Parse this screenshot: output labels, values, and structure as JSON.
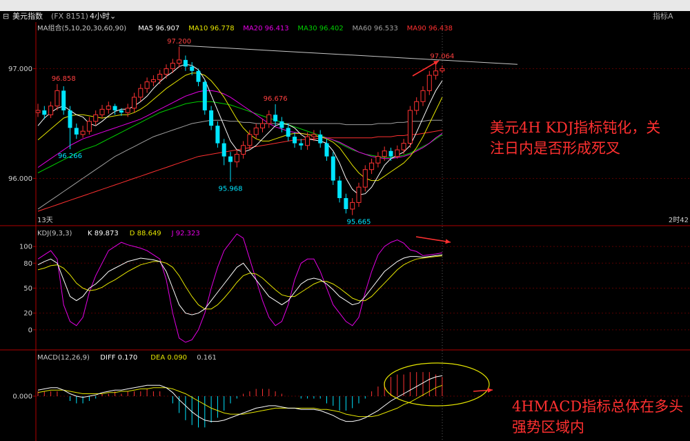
{
  "window": {
    "symbol": "美元指数",
    "code": "(FX 8151)",
    "period": "4小时",
    "right_label": "指标A"
  },
  "colors": {
    "up": "#ff3232",
    "down": "#00e5ff",
    "ma5": "#ffffff",
    "ma10": "#e6e600",
    "ma20": "#e600e6",
    "ma30": "#00d000",
    "ma60": "#a0a0a0",
    "ma90": "#ff3030",
    "grid": "#5a0000",
    "axis": "#b00000"
  },
  "main": {
    "legend": [
      {
        "text": "MA组合(5,10,20,30,60,90)",
        "color": "#c8c8c8"
      },
      {
        "text": "MA5 96.907",
        "color": "#ffffff"
      },
      {
        "text": "MA10 96.778",
        "color": "#e6e600"
      },
      {
        "text": "MA20 96.413",
        "color": "#e600e6"
      },
      {
        "text": "MA30 96.402",
        "color": "#00d000"
      },
      {
        "text": "MA60 96.533",
        "color": "#a0a0a0"
      },
      {
        "text": "MA90 96.438",
        "color": "#ff3030"
      }
    ],
    "y_ticks": [
      "97.000",
      "96.000"
    ],
    "y_tick_values": [
      97.0,
      96.0
    ],
    "ylim": [
      95.6,
      97.4
    ],
    "bottom_left": "13天",
    "bottom_right": "2时42",
    "price_labels": [
      {
        "text": "97.200",
        "i": 22,
        "value": 97.2,
        "pos": "above",
        "color": "#ff4040"
      },
      {
        "text": "96.858",
        "i": 4,
        "value": 96.858,
        "pos": "above",
        "color": "#ff4040"
      },
      {
        "text": "96.266",
        "i": 5,
        "value": 96.266,
        "pos": "below",
        "color": "#00e5ff"
      },
      {
        "text": "95.968",
        "i": 30,
        "value": 95.968,
        "pos": "below",
        "color": "#00e5ff"
      },
      {
        "text": "96.676",
        "i": 37,
        "value": 96.676,
        "pos": "above",
        "color": "#ff4040"
      },
      {
        "text": "95.665",
        "i": 50,
        "value": 95.665,
        "pos": "below",
        "color": "#00e5ff"
      },
      {
        "text": "97.064",
        "i": 63,
        "value": 97.064,
        "pos": "above",
        "color": "#ff4040"
      }
    ]
  },
  "kdj": {
    "legend": [
      {
        "text": "KDJ(9,3,3)",
        "color": "#c8c8c8"
      },
      {
        "text": "K 89.873",
        "color": "#ffffff"
      },
      {
        "text": "D 88.649",
        "color": "#e6e600"
      },
      {
        "text": "J 92.323",
        "color": "#e600e6"
      }
    ],
    "y_ticks": [
      "100",
      "80",
      "50",
      "20",
      "0"
    ],
    "y_tick_values": [
      100,
      80,
      50,
      20,
      0
    ],
    "ylim": [
      -20,
      120
    ]
  },
  "macd": {
    "legend": [
      {
        "text": "MACD(12,26,9)",
        "color": "#c8c8c8"
      },
      {
        "text": "DIFF 0.170",
        "color": "#ffffff"
      },
      {
        "text": "DEA 0.090",
        "color": "#e6e600"
      },
      {
        "text": "0.161",
        "color": "#c8c8c8"
      }
    ],
    "y_ticks": [
      "0.000"
    ],
    "y_tick_values": [
      0.0
    ],
    "ylim": [
      -0.35,
      0.35
    ]
  },
  "annotations": {
    "kdj_note": "美元4H KDJ指标钝化，关\n注日内是否形成死叉",
    "macd_note": "4HMACD指标总体在多头\n强势区域内"
  },
  "chart_data": {
    "type": "candlestick",
    "open": [
      96.6,
      96.62,
      96.58,
      96.66,
      96.8,
      96.62,
      96.46,
      96.4,
      96.43,
      96.52,
      96.58,
      96.63,
      96.66,
      96.62,
      96.6,
      96.64,
      96.74,
      96.82,
      96.88,
      96.9,
      96.95,
      97.0,
      97.05,
      97.08,
      97.02,
      96.98,
      96.88,
      96.62,
      96.48,
      96.32,
      96.2,
      96.15,
      96.22,
      96.3,
      96.4,
      96.46,
      96.5,
      96.58,
      96.52,
      96.46,
      96.38,
      96.32,
      96.3,
      96.38,
      96.4,
      96.32,
      96.2,
      95.98,
      95.82,
      95.72,
      95.78,
      95.92,
      96.08,
      96.14,
      96.2,
      96.25,
      96.2,
      96.26,
      96.32,
      96.62,
      96.7,
      96.8,
      96.94,
      96.98
    ],
    "close": [
      96.62,
      96.58,
      96.66,
      96.8,
      96.62,
      96.46,
      96.4,
      96.43,
      96.52,
      96.58,
      96.63,
      96.66,
      96.62,
      96.6,
      96.64,
      96.74,
      96.82,
      96.88,
      96.9,
      96.95,
      97.0,
      97.05,
      97.08,
      97.02,
      96.98,
      96.88,
      96.62,
      96.48,
      96.32,
      96.2,
      96.15,
      96.22,
      96.3,
      96.4,
      96.46,
      96.5,
      96.58,
      96.52,
      96.46,
      96.38,
      96.32,
      96.3,
      96.38,
      96.4,
      96.32,
      96.2,
      95.98,
      95.82,
      95.72,
      95.78,
      95.92,
      96.08,
      96.14,
      96.2,
      96.25,
      96.2,
      96.26,
      96.32,
      96.62,
      96.7,
      96.8,
      96.94,
      96.98,
      97.0
    ],
    "high": [
      96.68,
      96.66,
      96.7,
      96.86,
      96.84,
      96.66,
      96.5,
      96.48,
      96.56,
      96.62,
      96.67,
      96.7,
      96.68,
      96.64,
      96.68,
      96.78,
      96.86,
      96.92,
      96.94,
      96.99,
      97.04,
      97.09,
      97.2,
      97.12,
      97.06,
      97.0,
      96.9,
      96.66,
      96.52,
      96.36,
      96.24,
      96.26,
      96.34,
      96.44,
      96.5,
      96.54,
      96.62,
      96.676,
      96.56,
      96.5,
      96.42,
      96.36,
      96.42,
      96.44,
      96.44,
      96.36,
      96.24,
      96.02,
      95.86,
      95.82,
      95.96,
      96.12,
      96.18,
      96.24,
      96.29,
      96.28,
      96.3,
      96.36,
      96.66,
      96.74,
      96.84,
      96.98,
      97.064,
      97.03
    ],
    "low": [
      96.56,
      96.54,
      96.55,
      96.62,
      96.58,
      96.266,
      96.36,
      96.37,
      96.4,
      96.48,
      96.55,
      96.59,
      96.58,
      96.57,
      96.56,
      96.6,
      96.7,
      96.78,
      96.84,
      96.86,
      96.91,
      96.96,
      97.01,
      96.98,
      96.94,
      96.84,
      96.58,
      96.44,
      96.28,
      96.12,
      95.968,
      96.1,
      96.18,
      96.26,
      96.36,
      96.42,
      96.46,
      96.48,
      96.42,
      96.34,
      96.28,
      96.26,
      96.26,
      96.34,
      96.28,
      96.16,
      95.94,
      95.78,
      95.68,
      95.665,
      95.74,
      95.88,
      96.04,
      96.1,
      96.16,
      96.16,
      96.18,
      96.22,
      96.28,
      96.58,
      96.66,
      96.76,
      96.9,
      96.96
    ],
    "ma5": [
      96.48,
      96.55,
      96.6,
      96.64,
      96.66,
      96.62,
      96.58,
      96.56,
      96.5,
      96.48,
      96.52,
      96.57,
      96.61,
      96.63,
      96.63,
      96.66,
      96.7,
      96.75,
      96.82,
      96.88,
      96.93,
      96.97,
      97.02,
      97.04,
      97.03,
      96.99,
      96.9,
      96.76,
      96.62,
      96.48,
      96.34,
      96.26,
      96.24,
      96.26,
      96.3,
      96.36,
      96.42,
      96.48,
      96.5,
      96.49,
      96.46,
      96.4,
      96.36,
      96.35,
      96.34,
      96.32,
      96.25,
      96.14,
      96.0,
      95.9,
      95.85,
      95.86,
      95.92,
      96.02,
      96.12,
      96.18,
      96.21,
      96.24,
      96.3,
      96.42,
      96.55,
      96.68,
      96.8,
      96.89
    ],
    "ma10": [
      96.35,
      96.4,
      96.45,
      96.5,
      96.55,
      96.57,
      96.58,
      96.58,
      96.57,
      96.56,
      96.55,
      96.56,
      96.57,
      96.58,
      96.58,
      96.6,
      96.63,
      96.67,
      96.72,
      96.77,
      96.82,
      96.86,
      96.9,
      96.94,
      96.96,
      96.96,
      96.94,
      96.89,
      96.82,
      96.74,
      96.64,
      96.54,
      96.46,
      96.4,
      96.36,
      96.34,
      96.34,
      96.36,
      96.38,
      96.4,
      96.41,
      96.41,
      96.4,
      96.39,
      96.38,
      96.36,
      96.33,
      96.28,
      96.2,
      96.12,
      96.05,
      96.0,
      95.98,
      95.98,
      96.02,
      96.06,
      96.1,
      96.14,
      96.2,
      96.28,
      96.38,
      96.5,
      96.62,
      96.74
    ],
    "ma20": [
      96.1,
      96.14,
      96.18,
      96.22,
      96.26,
      96.3,
      96.33,
      96.36,
      96.38,
      96.4,
      96.42,
      96.44,
      96.46,
      96.48,
      96.5,
      96.52,
      96.54,
      96.57,
      96.6,
      96.63,
      96.66,
      96.69,
      96.72,
      96.75,
      96.77,
      96.79,
      96.8,
      96.8,
      96.79,
      96.77,
      96.74,
      96.7,
      96.66,
      96.62,
      96.58,
      96.54,
      96.5,
      96.47,
      96.45,
      96.43,
      96.42,
      96.41,
      96.4,
      96.39,
      96.38,
      96.37,
      96.35,
      96.33,
      96.3,
      96.27,
      96.24,
      96.22,
      96.2,
      96.19,
      96.18,
      96.18,
      96.19,
      96.2,
      96.22,
      96.25,
      96.28,
      96.32,
      96.37,
      96.41
    ],
    "ma30": [
      96.05,
      96.08,
      96.11,
      96.14,
      96.17,
      96.2,
      96.23,
      96.26,
      96.28,
      96.3,
      96.33,
      96.36,
      96.39,
      96.42,
      96.45,
      96.48,
      96.51,
      96.54,
      96.57,
      96.6,
      96.62,
      96.64,
      96.66,
      96.68,
      96.69,
      96.7,
      96.7,
      96.7,
      96.69,
      96.68,
      96.67,
      96.65,
      96.63,
      96.61,
      96.59,
      96.57,
      96.55,
      96.53,
      96.51,
      96.49,
      96.47,
      96.45,
      96.43,
      96.41,
      96.39,
      96.37,
      96.35,
      96.32,
      96.29,
      96.26,
      96.24,
      96.22,
      96.21,
      96.2,
      96.19,
      96.19,
      96.2,
      96.21,
      96.23,
      96.26,
      96.29,
      96.32,
      96.36,
      96.4
    ],
    "ma60": [
      95.72,
      95.76,
      95.8,
      95.84,
      95.88,
      95.92,
      95.96,
      96.0,
      96.04,
      96.08,
      96.12,
      96.16,
      96.2,
      96.23,
      96.26,
      96.29,
      96.32,
      96.35,
      96.38,
      96.4,
      96.42,
      96.44,
      96.46,
      96.48,
      96.5,
      96.51,
      96.52,
      96.53,
      96.53,
      96.53,
      96.52,
      96.52,
      96.51,
      96.51,
      96.5,
      96.5,
      96.5,
      96.5,
      96.5,
      96.5,
      96.5,
      96.5,
      96.5,
      96.5,
      96.5,
      96.5,
      96.5,
      96.5,
      96.49,
      96.49,
      96.49,
      96.49,
      96.49,
      96.5,
      96.5,
      96.5,
      96.51,
      96.51,
      96.52,
      96.52,
      96.52,
      96.53,
      96.53,
      96.53
    ],
    "ma90": [
      95.7,
      95.72,
      95.74,
      95.76,
      95.78,
      95.8,
      95.82,
      95.84,
      95.86,
      95.88,
      95.9,
      95.92,
      95.94,
      95.96,
      95.98,
      96.0,
      96.02,
      96.04,
      96.06,
      96.08,
      96.1,
      96.12,
      96.14,
      96.16,
      96.18,
      96.2,
      96.21,
      96.22,
      96.23,
      96.24,
      96.25,
      96.26,
      96.27,
      96.28,
      96.29,
      96.3,
      96.31,
      96.32,
      96.33,
      96.34,
      96.35,
      96.35,
      96.36,
      96.36,
      96.37,
      96.37,
      96.37,
      96.37,
      96.37,
      96.37,
      96.37,
      96.37,
      96.37,
      96.38,
      96.38,
      96.38,
      96.39,
      96.39,
      96.4,
      96.4,
      96.41,
      96.42,
      96.43,
      96.44
    ],
    "kdj_k": [
      78,
      82,
      85,
      80,
      60,
      40,
      35,
      40,
      50,
      55,
      62,
      70,
      74,
      78,
      82,
      84,
      86,
      85,
      84,
      82,
      70,
      50,
      30,
      20,
      18,
      20,
      25,
      35,
      45,
      55,
      65,
      75,
      80,
      70,
      60,
      50,
      40,
      35,
      30,
      35,
      45,
      55,
      60,
      62,
      60,
      55,
      48,
      40,
      35,
      30,
      32,
      40,
      50,
      60,
      70,
      76,
      82,
      86,
      88,
      88,
      87,
      88,
      89,
      89.873
    ],
    "kdj_d": [
      72,
      74,
      77,
      78,
      74,
      66,
      56,
      50,
      47,
      48,
      51,
      56,
      60,
      65,
      70,
      74,
      78,
      80,
      82,
      82,
      80,
      75,
      65,
      52,
      40,
      30,
      25,
      25,
      30,
      38,
      47,
      57,
      65,
      68,
      67,
      62,
      55,
      48,
      42,
      40,
      40,
      45,
      50,
      55,
      58,
      58,
      55,
      50,
      44,
      38,
      35,
      35,
      40,
      48,
      56,
      64,
      72,
      78,
      82,
      85,
      86,
      87,
      88,
      88.649
    ],
    "kdj_j": [
      85,
      90,
      95,
      85,
      30,
      10,
      5,
      15,
      45,
      65,
      80,
      95,
      100,
      105,
      102,
      100,
      98,
      95,
      90,
      85,
      60,
      20,
      -10,
      -15,
      -12,
      0,
      20,
      50,
      75,
      95,
      105,
      115,
      110,
      85,
      60,
      35,
      15,
      5,
      10,
      30,
      60,
      80,
      85,
      85,
      70,
      50,
      30,
      20,
      10,
      5,
      15,
      45,
      70,
      90,
      100,
      105,
      108,
      104,
      96,
      94,
      89,
      90,
      91,
      92.323
    ],
    "macd_diff": [
      0.05,
      0.06,
      0.07,
      0.07,
      0.05,
      0.02,
      0.0,
      -0.01,
      0.0,
      0.01,
      0.03,
      0.04,
      0.05,
      0.05,
      0.06,
      0.07,
      0.08,
      0.09,
      0.09,
      0.09,
      0.07,
      0.03,
      -0.03,
      -0.08,
      -0.13,
      -0.17,
      -0.2,
      -0.21,
      -0.21,
      -0.2,
      -0.18,
      -0.16,
      -0.14,
      -0.12,
      -0.1,
      -0.09,
      -0.08,
      -0.08,
      -0.09,
      -0.1,
      -0.1,
      -0.11,
      -0.11,
      -0.11,
      -0.12,
      -0.14,
      -0.16,
      -0.19,
      -0.21,
      -0.21,
      -0.2,
      -0.18,
      -0.15,
      -0.12,
      -0.08,
      -0.04,
      -0.01,
      0.02,
      0.05,
      0.08,
      0.11,
      0.14,
      0.16,
      0.17
    ],
    "macd_dea": [
      0.03,
      0.04,
      0.05,
      0.05,
      0.05,
      0.04,
      0.03,
      0.02,
      0.02,
      0.02,
      0.02,
      0.03,
      0.03,
      0.04,
      0.04,
      0.05,
      0.06,
      0.06,
      0.07,
      0.07,
      0.07,
      0.06,
      0.04,
      0.02,
      -0.01,
      -0.04,
      -0.07,
      -0.1,
      -0.12,
      -0.14,
      -0.15,
      -0.15,
      -0.15,
      -0.14,
      -0.13,
      -0.12,
      -0.11,
      -0.1,
      -0.1,
      -0.1,
      -0.1,
      -0.1,
      -0.1,
      -0.1,
      -0.11,
      -0.11,
      -0.12,
      -0.13,
      -0.15,
      -0.16,
      -0.17,
      -0.17,
      -0.17,
      -0.16,
      -0.14,
      -0.12,
      -0.1,
      -0.07,
      -0.05,
      -0.02,
      0.01,
      0.04,
      0.07,
      0.09
    ]
  }
}
